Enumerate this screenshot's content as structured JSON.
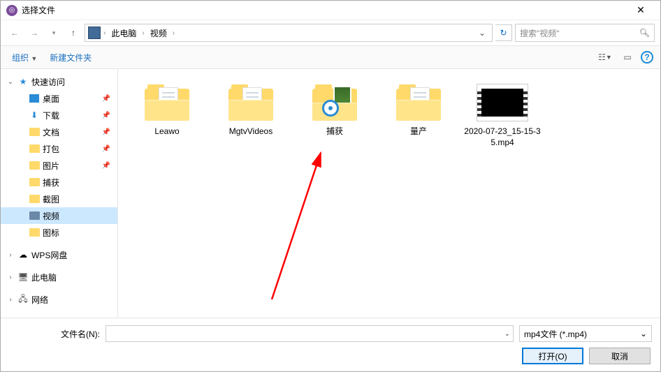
{
  "window": {
    "title": "选择文件"
  },
  "nav": {
    "breadcrumb": {
      "root": "此电脑",
      "current": "视频"
    },
    "search_placeholder": "搜索\"视频\""
  },
  "toolbar": {
    "organize": "组织",
    "new_folder": "新建文件夹"
  },
  "sidebar": {
    "quick_access": "快速访问",
    "items": [
      {
        "label": "桌面",
        "pinned": true
      },
      {
        "label": "下载",
        "pinned": true
      },
      {
        "label": "文档",
        "pinned": true
      },
      {
        "label": "打包",
        "pinned": true
      },
      {
        "label": "图片",
        "pinned": true
      },
      {
        "label": "捕获",
        "pinned": false
      },
      {
        "label": "截图",
        "pinned": false
      },
      {
        "label": "视频",
        "pinned": false,
        "selected": true
      },
      {
        "label": "图标",
        "pinned": false
      }
    ],
    "wps": "WPS网盘",
    "this_pc": "此电脑",
    "network": "网络"
  },
  "files": [
    {
      "name": "Leawo",
      "type": "folder-doc"
    },
    {
      "name": "MgtvVideos",
      "type": "folder-doc"
    },
    {
      "name": "捕获",
      "type": "folder-media"
    },
    {
      "name": "量产",
      "type": "folder-doc"
    },
    {
      "name": "2020-07-23_15-15-35.mp4",
      "type": "video"
    }
  ],
  "footer": {
    "filename_label": "文件名(N):",
    "filename_value": "",
    "filetype": "mp4文件 (*.mp4)",
    "open": "打开(O)",
    "cancel": "取消"
  }
}
